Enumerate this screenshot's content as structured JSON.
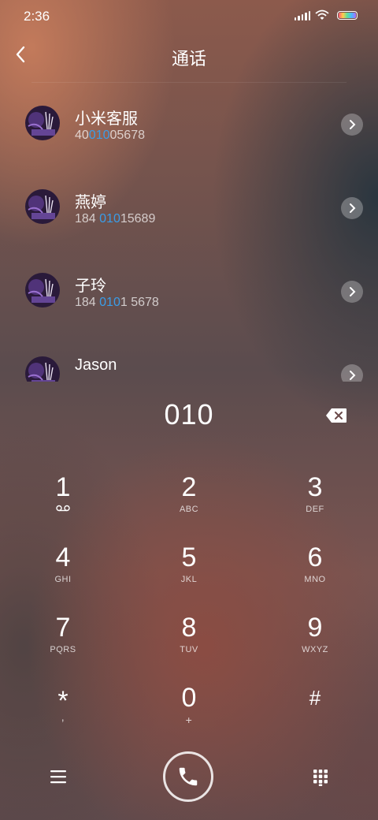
{
  "status": {
    "time": "2:36"
  },
  "header": {
    "title": "通话"
  },
  "contacts": [
    {
      "name": "小米客服",
      "num_pre": "40",
      "num_hl": "010",
      "num_post": "05678"
    },
    {
      "name": "燕婷",
      "num_pre": "184 ",
      "num_hl": "010",
      "num_post": "15689"
    },
    {
      "name": "子玲",
      "num_pre": "184 ",
      "num_hl": "010",
      "num_post": "1 5678"
    },
    {
      "name": "Jason"
    }
  ],
  "dialer": {
    "input": "010",
    "keys": [
      {
        "digit": "1",
        "letters": ""
      },
      {
        "digit": "2",
        "letters": "ABC"
      },
      {
        "digit": "3",
        "letters": "DEF"
      },
      {
        "digit": "4",
        "letters": "GHI"
      },
      {
        "digit": "5",
        "letters": "JKL"
      },
      {
        "digit": "6",
        "letters": "MNO"
      },
      {
        "digit": "7",
        "letters": "PQRS"
      },
      {
        "digit": "8",
        "letters": "TUV"
      },
      {
        "digit": "9",
        "letters": "WXYZ"
      },
      {
        "digit": "*",
        "letters": ","
      },
      {
        "digit": "0",
        "letters": "+"
      },
      {
        "digit": "#",
        "letters": ""
      }
    ]
  },
  "colors": {
    "highlight": "#3a9de8"
  },
  "icons": {
    "back": "chevron-left-icon",
    "backspace": "backspace-icon",
    "voicemail": "voicemail-icon",
    "menu": "menu-icon",
    "call": "phone-icon",
    "keypad": "keypad-icon",
    "detail": "chevron-right-icon"
  }
}
